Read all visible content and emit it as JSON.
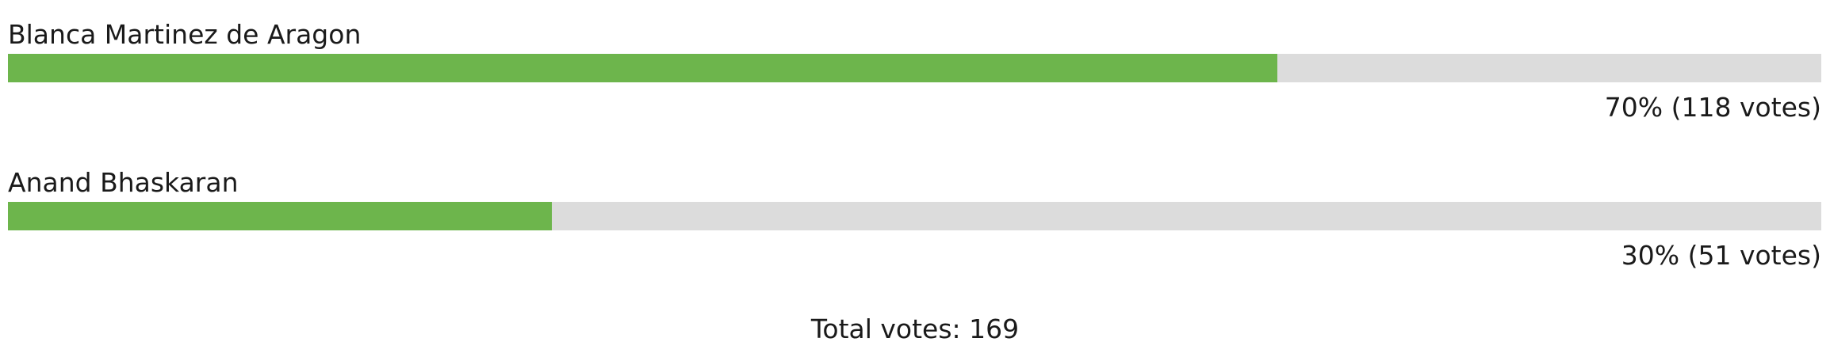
{
  "poll": {
    "options": [
      {
        "name": "Blanca Martinez de Aragon",
        "fraction": 0.7,
        "result": "70% (118 votes)"
      },
      {
        "name": "Anand Bhaskaran",
        "fraction": 0.3,
        "result": "30% (51 votes)"
      }
    ],
    "total": "Total votes: 169",
    "colors": {
      "fill": "#6db54c",
      "track": "#dcdcdc"
    }
  }
}
